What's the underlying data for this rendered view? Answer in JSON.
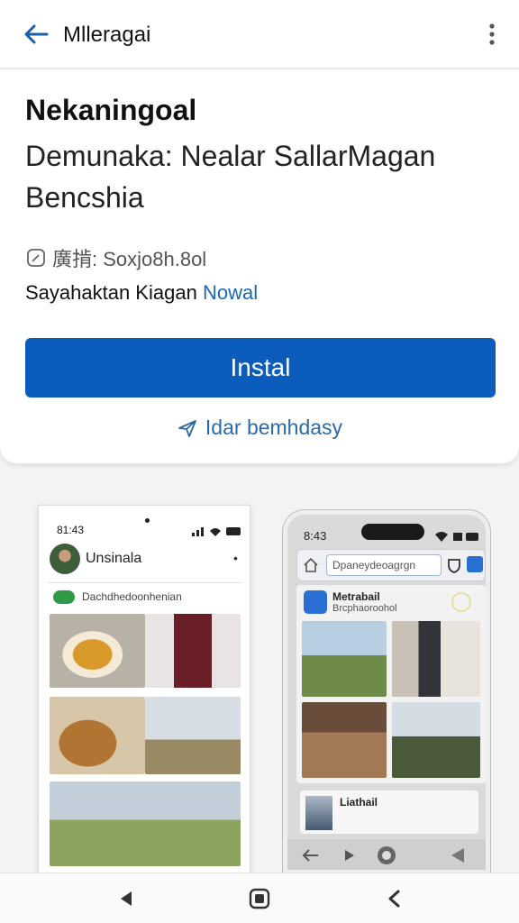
{
  "topbar": {
    "title": "Mlleragai",
    "back_icon": "arrow-left-icon",
    "more_icon": "more-vert-icon"
  },
  "app": {
    "name": "Nekaningoal",
    "description": "Demunaka: Nealar SallarMagan Bencshia",
    "meta_text": "廣掯: Soxjo8h.8ol",
    "developer_label": "Sayahaktan Kiagan",
    "developer_link": "Nowal",
    "install_label": "Instal",
    "secondary_label": "Idar bemhdasy"
  },
  "screenshot1": {
    "time": "81:43",
    "title": "Unsinala",
    "tag_text": "Dachdhedoonhenian"
  },
  "screenshot2": {
    "time": "8:43",
    "url_text": "Dpaneydeoagrgn",
    "post_title": "Metrabail",
    "post_subtitle": "Brcphaoroohol",
    "card_title": "Liathail"
  },
  "colors": {
    "accent": "#0c5cbd",
    "link": "#1a67b5",
    "secondary": "#2a6aa8"
  }
}
